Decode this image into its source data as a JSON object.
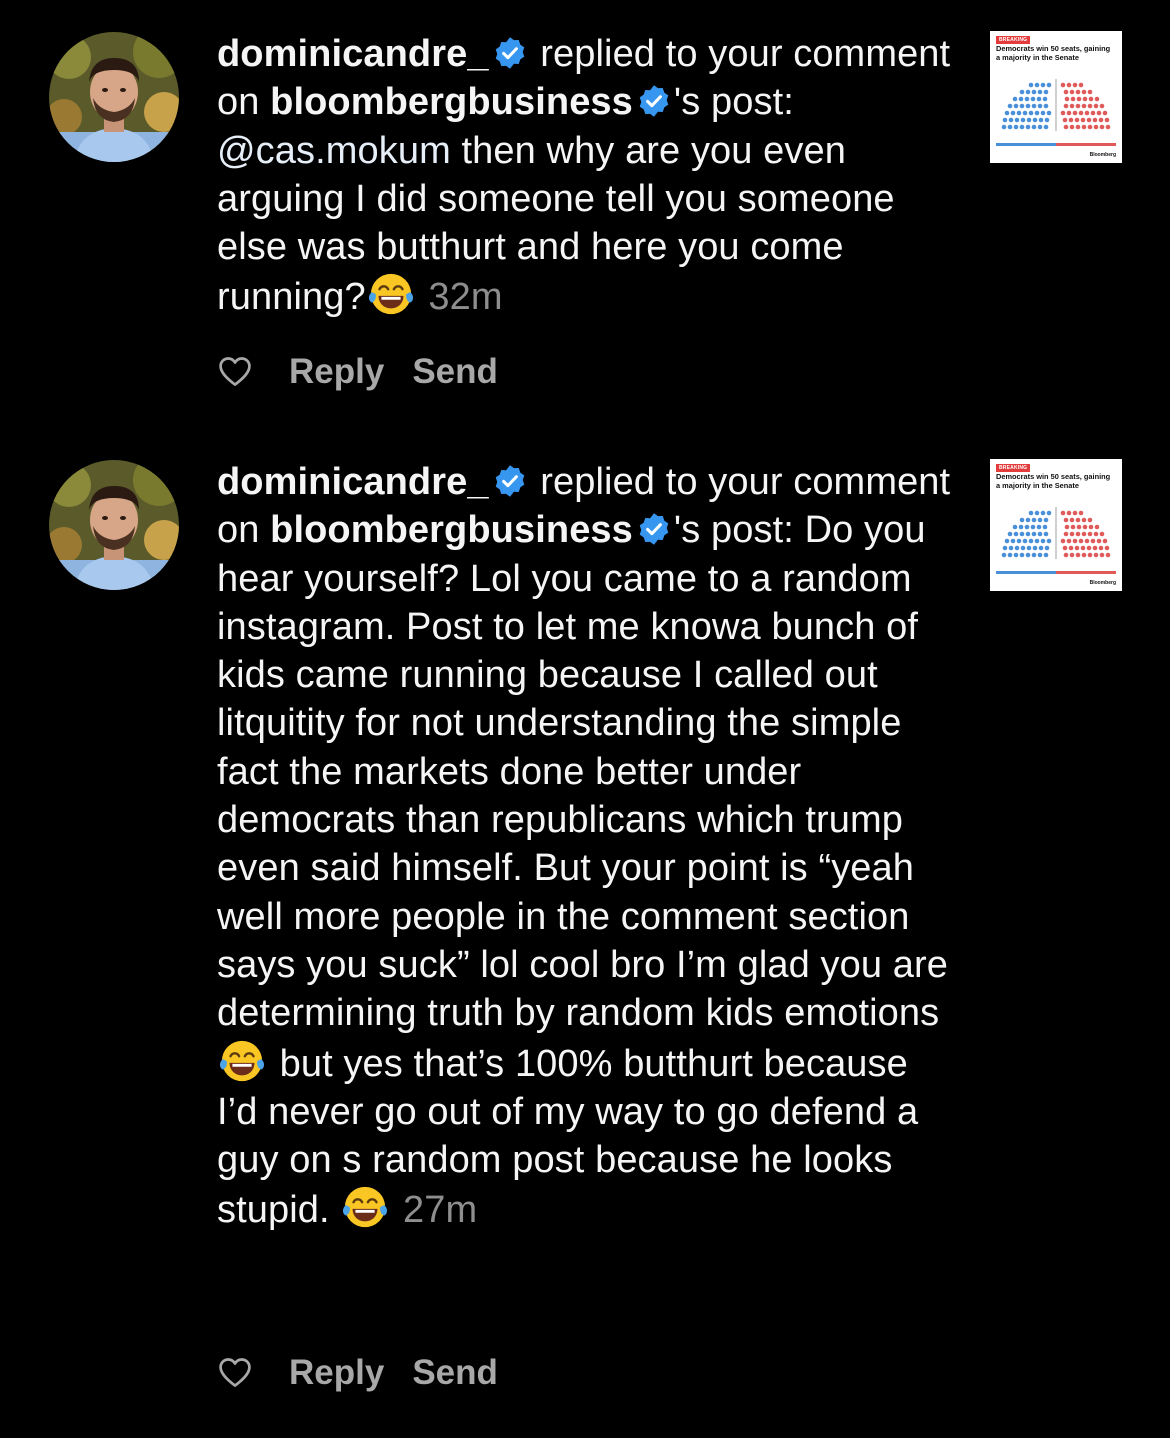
{
  "notifications": [
    {
      "username": "dominicandre_",
      "action_text": "replied to your comment on",
      "post_owner": "bloombergbusiness",
      "possessive": "'s post:",
      "mention": "@cas.mokum",
      "body": "then why are you even arguing I did someone tell you someone else was butthurt and here you come running?",
      "emoji": "face-with-tears-of-joy",
      "time": "32m",
      "reply_label": "Reply",
      "send_label": "Send",
      "thumbnail": {
        "tag": "BREAKING",
        "headline": "Democrats win 50 seats, gaining a majority in the Senate",
        "brand": "Bloomberg"
      }
    },
    {
      "username": "dominicandre_",
      "action_text": "replied to your comment on",
      "post_owner": "bloombergbusiness",
      "possessive": "'s post:",
      "body_part1": "Do you hear yourself? Lol you came to a random instagram. Post to let me knowa bunch of kids came running because I called out litquitity for not understanding the simple fact the markets done better under democrats than republicans which trump even said himself. But your point is “yeah well more people in the comment section says you suck” lol cool bro I’m glad you are determining truth by random kids emotions",
      "body_part2": "but yes that’s 100% butthurt because I’d never go out of my way to go defend a guy on s random post because he looks stupid.",
      "emoji": "face-with-tears-of-joy",
      "time": "27m",
      "reply_label": "Reply",
      "send_label": "Send",
      "thumbnail": {
        "tag": "BREAKING",
        "headline": "Democrats win 50 seats, gaining a majority in the Senate",
        "brand": "Bloomberg"
      }
    }
  ],
  "colors": {
    "background": "#000000",
    "text": "#f5f5f5",
    "muted": "#8e8e8e",
    "verified": "#3797f0",
    "democrat_blue": "#4a90d9",
    "republican_red": "#e05a5a"
  }
}
